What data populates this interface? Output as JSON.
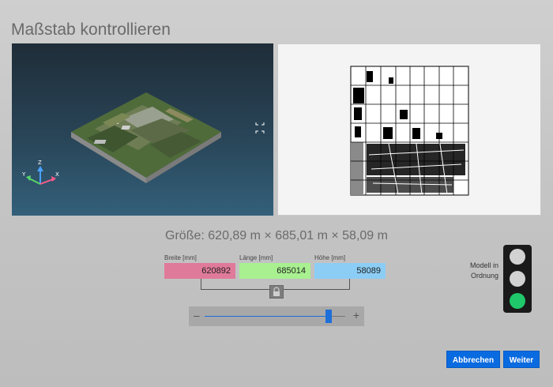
{
  "page": {
    "title": "Maßstab kontrollieren"
  },
  "viewport3d": {
    "axes": {
      "x": "X",
      "y": "Y",
      "z": "Z"
    },
    "expand_icon": "expand-icon"
  },
  "size_summary": "Größe: 620,89 m × 685,01 m × 58,09 m",
  "dimensions": {
    "width": {
      "label": "Breite [mm]",
      "value": "620892",
      "color": "#e07a9a"
    },
    "length": {
      "label": "Länge [mm]",
      "value": "685014",
      "color": "#a8f090"
    },
    "height": {
      "label": "Höhe [mm]",
      "value": "58089",
      "color": "#8ccdf5"
    },
    "lock_icon": "lock-icon"
  },
  "scale_slider": {
    "minus": "–",
    "plus": "+",
    "value_fraction": 0.88
  },
  "status": {
    "label_line1": "Modell in",
    "label_line2": "Ordnung",
    "active_light": "green"
  },
  "buttons": {
    "cancel": "Abbrechen",
    "next": "Weiter"
  },
  "colors": {
    "accent": "#0a6be0",
    "ok": "#1fc86a"
  }
}
